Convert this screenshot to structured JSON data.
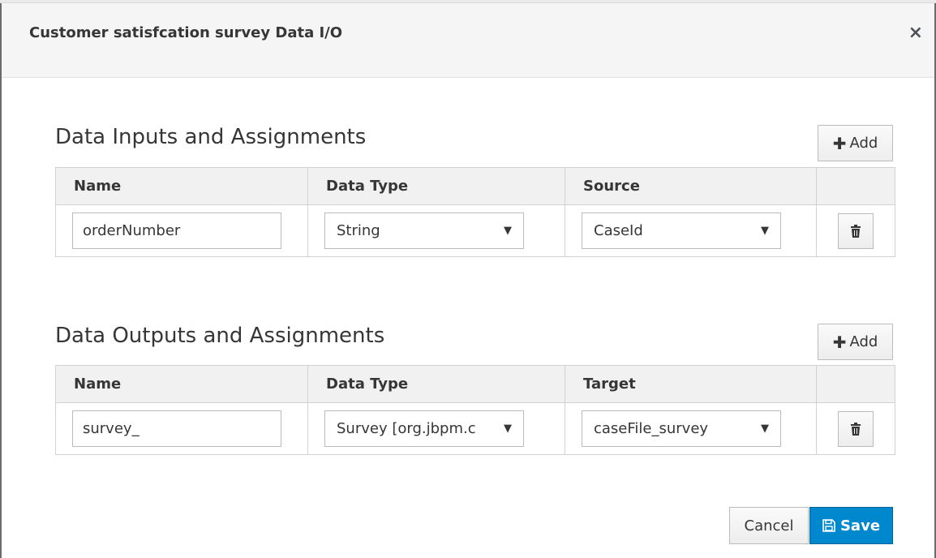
{
  "dialog": {
    "title": "Customer satisfcation survey Data I/O",
    "close_label": "×"
  },
  "inputs": {
    "title": "Data Inputs and Assignments",
    "add_label": "Add",
    "columns": [
      "Name",
      "Data Type",
      "Source"
    ],
    "rows": [
      {
        "name": "orderNumber",
        "data_type": "String",
        "source": "CaseId"
      }
    ]
  },
  "outputs": {
    "title": "Data Outputs and Assignments",
    "add_label": "Add",
    "columns": [
      "Name",
      "Data Type",
      "Target"
    ],
    "rows": [
      {
        "name": "survey_",
        "data_type": "Survey [org.jbpm.c",
        "target": "caseFile_survey"
      }
    ]
  },
  "footer": {
    "cancel_label": "Cancel",
    "save_label": "Save"
  },
  "colors": {
    "primary": "#0088ce",
    "header_bg": "#f5f5f5"
  },
  "icons": [
    "close-icon",
    "plus-icon",
    "trash-icon",
    "caret-down-icon",
    "save-icon"
  ]
}
